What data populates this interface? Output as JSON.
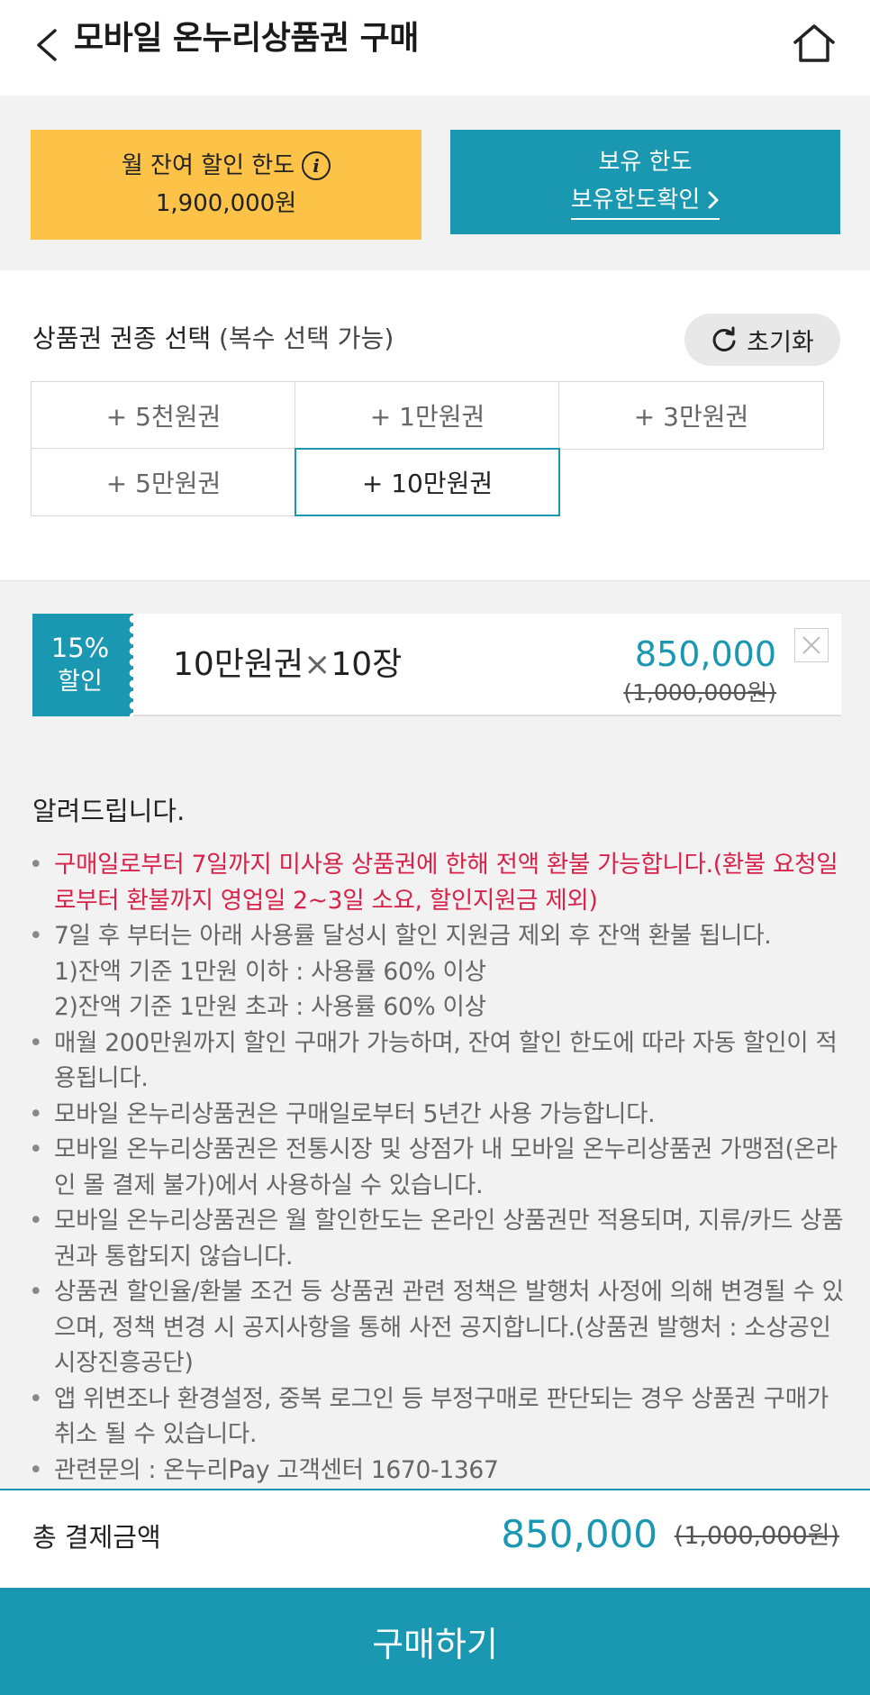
{
  "header": {
    "title": "모바일 온누리상품권 구매",
    "back_icon": "chevron-left-icon",
    "home_icon": "home-icon"
  },
  "limits": {
    "monthly": {
      "label": "월 잔여 할인 한도",
      "value": "1,900,000원",
      "color": "#fdc248"
    },
    "holding": {
      "label": "보유 한도",
      "link": "보유한도확인",
      "color": "#1a97b1"
    }
  },
  "denominations": {
    "title": "상품권 권종 선택",
    "subtitle": "(복수 선택 가능)",
    "reset_label": "초기화",
    "items": [
      {
        "label": "+ 5천원권",
        "selected": false
      },
      {
        "label": "+ 1만원권",
        "selected": false
      },
      {
        "label": "+ 3만원권",
        "selected": false
      },
      {
        "label": "+ 5만원권",
        "selected": false
      },
      {
        "label": "+ 10만원권",
        "selected": true
      }
    ]
  },
  "selected_item": {
    "discount_pct": "15%",
    "discount_label": "할인",
    "name": "10만원권",
    "times": "×",
    "qty": "10장",
    "price": "850,000",
    "original": "(1,000,000원)"
  },
  "notice": {
    "title": "알려드립니다.",
    "items": [
      {
        "text": "구매일로부터 7일까지 미사용 상품권에 한해 전액 환불 가능합니다.(환불 요청일로부터 환불까지 영업일 2~3일 소요, 할인지원금 제외)",
        "highlight": true
      },
      {
        "text": "7일 후 부터는 아래 사용률 달성시 할인 지원금 제외 후 잔액 환불 됩니다.",
        "highlight": false,
        "subs": [
          "1)잔액 기준 1만원 이하 : 사용률 60% 이상",
          "2)잔액 기준 1만원 초과 : 사용률 60% 이상"
        ]
      },
      {
        "text": "매월 200만원까지 할인 구매가 가능하며, 잔여 할인 한도에 따라 자동 할인이 적용됩니다.",
        "highlight": false
      },
      {
        "text": "모바일 온누리상품권은 구매일로부터 5년간 사용 가능합니다.",
        "highlight": false
      },
      {
        "text": "모바일 온누리상품권은 전통시장 및 상점가 내 모바일 온누리상품권 가맹점(온라인 몰 결제 불가)에서 사용하실 수 있습니다.",
        "highlight": false
      },
      {
        "text": "모바일 온누리상품권은 월 할인한도는 온라인 상품권만 적용되며, 지류/카드 상품권과 통합되지 않습니다.",
        "highlight": false
      },
      {
        "text": "상품권 할인율/환불 조건 등 상품권 관련 정책은 발행처 사정에 의해 변경될 수 있으며, 정책 변경 시 공지사항을 통해 사전 공지합니다.(상품권 발행처 : 소상공인시장진흥공단)",
        "highlight": false
      },
      {
        "text": "앱 위변조나 환경설정, 중복 로그인 등 부정구매로 판단되는 경우 상품권 구매가 취소 될 수 있습니다.",
        "highlight": false
      },
      {
        "text": "관련문의 : 온누리Pay 고객센터 1670-1367",
        "highlight": false
      }
    ]
  },
  "total": {
    "label": "총 결제금액",
    "price": "850,000",
    "original": "(1,000,000원)"
  },
  "buy_label": "구매하기",
  "colors": {
    "accent": "#1a97b1",
    "yellow": "#fdc248",
    "highlight_red": "#d8224a"
  }
}
